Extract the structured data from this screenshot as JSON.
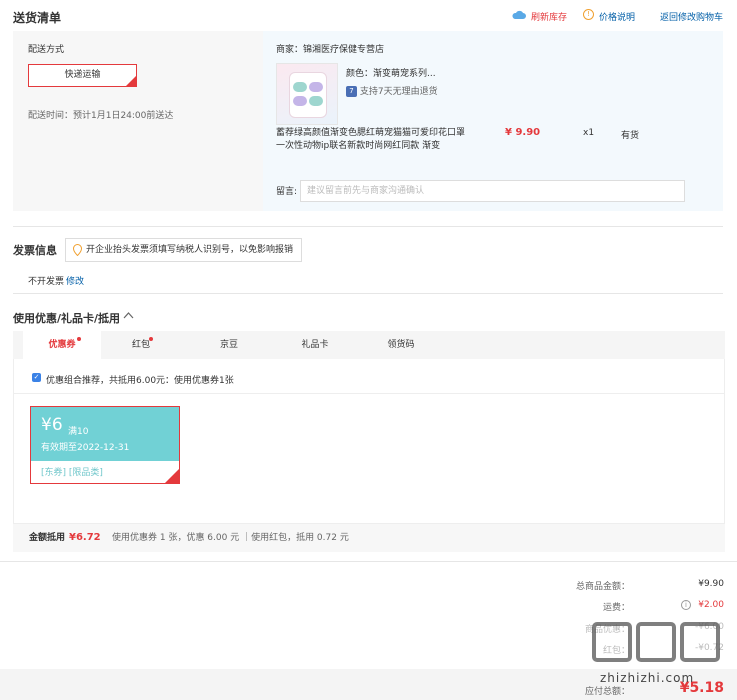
{
  "header": {
    "title": "送货清单",
    "refresh_stock": "刷新库存",
    "price_info": "价格说明",
    "back_to_cart": "返回修改购物车"
  },
  "shipping": {
    "label": "配送方式",
    "method": "快递运输",
    "time": "配送时间：预计1月1日24:00前送达"
  },
  "shop": {
    "name": "商家：锦湘医疗保健专营店",
    "color": "颜色：渐变萌宠系列...",
    "return_policy": "支持7天无理由退货",
    "product_name": "蓄荐绿高颜值渐变色腮红萌宠猫猫可爱印花口罩一次性动物ip联名新款时尚网红同款 渐变",
    "price": "¥ 9.90",
    "qty": "x1",
    "stock": "有货",
    "memo_label": "留言:",
    "memo_placeholder": "建议留言前先与商家沟通确认"
  },
  "invoice": {
    "title": "发票信息",
    "tip": "开企业抬头发票须填写纳税人识别号，以免影响报销",
    "status": "不开发票",
    "edit": "修改"
  },
  "coupon_section": {
    "title": "使用优惠/礼品卡/抵用",
    "tabs": [
      {
        "label": "优惠券",
        "dot": true
      },
      {
        "label": "红包",
        "dot": true
      },
      {
        "label": "京豆",
        "dot": false
      },
      {
        "label": "礼品卡",
        "dot": false
      },
      {
        "label": "领货码",
        "dot": false
      }
    ],
    "recommend": "优惠组合推荐，共抵用6.00元：使用优惠券1张",
    "coupon": {
      "amount": "¥6",
      "condition": "满10",
      "expire": "有效期至2022-12-31",
      "tags": "[东券] [限品类]"
    },
    "summary_label": "金额抵用",
    "summary_amount": "¥6.72",
    "summary_detail": "使用优惠券 1 张，优惠 6.00 元 ｜使用红包，抵用 0.72 元"
  },
  "totals": {
    "goods_label": "总商品金额：",
    "goods_value": "¥9.90",
    "freight_label": "运费：",
    "freight_value": "¥2.00",
    "discount_label": "商品优惠：",
    "discount_value": "-¥6.00",
    "redpacket_label": "红包：",
    "redpacket_value": "-¥0.72",
    "payable_label": "应付总额：",
    "payable_value": "¥5.18"
  },
  "watermark": "zhizhizhi.com",
  "colors": {
    "accent": "#e4393c",
    "link": "#005ea7",
    "coupon": "#71d1d5"
  }
}
